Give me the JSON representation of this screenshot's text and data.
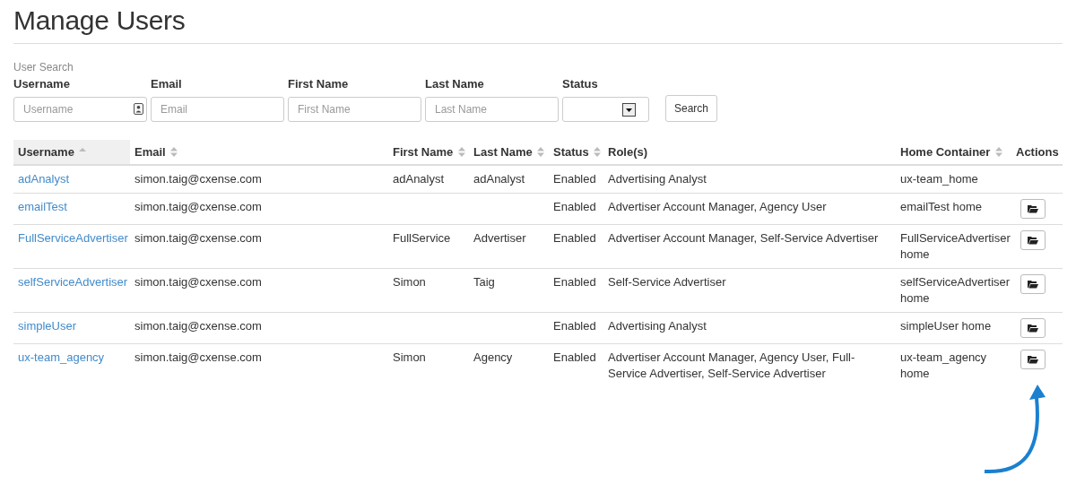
{
  "page": {
    "title": "Manage Users"
  },
  "search": {
    "heading": "User Search",
    "fields": [
      {
        "kind": "text",
        "label": "Username",
        "placeholder": "Username",
        "contact_icon": true
      },
      {
        "kind": "text",
        "label": "Email",
        "placeholder": "Email",
        "contact_icon": false
      },
      {
        "kind": "text",
        "label": "First Name",
        "placeholder": "First Name",
        "contact_icon": false
      },
      {
        "kind": "text",
        "label": "Last Name",
        "placeholder": "Last Name",
        "contact_icon": false
      },
      {
        "kind": "select",
        "label": "Status"
      }
    ],
    "button": "Search"
  },
  "table": {
    "columns": [
      {
        "label": "Username",
        "sortable": true,
        "sorted_ascending": true,
        "selected": true
      },
      {
        "label": "Email",
        "sortable": true,
        "sorted_ascending": false,
        "selected": false
      },
      {
        "label": "First Name",
        "sortable": true,
        "sorted_ascending": false,
        "selected": false
      },
      {
        "label": "Last Name",
        "sortable": true,
        "sorted_ascending": false,
        "selected": false
      },
      {
        "label": "Status",
        "sortable": true,
        "sorted_ascending": false,
        "selected": false
      },
      {
        "label": "Role(s)",
        "sortable": false,
        "selected": false
      },
      {
        "label": "Home Container",
        "sortable": true,
        "sorted_ascending": false,
        "selected": false
      },
      {
        "label": "Actions",
        "sortable": false,
        "selected": false
      }
    ],
    "rows": [
      {
        "username": "adAnalyst",
        "email": "simon.taig@cxense.com",
        "first_name": "adAnalyst",
        "last_name": "adAnalyst",
        "status": "Enabled",
        "roles": "Advertising Analyst",
        "home_container": "ux-team_home",
        "has_action": false
      },
      {
        "username": "emailTest",
        "email": "simon.taig@cxense.com",
        "first_name": "",
        "last_name": "",
        "status": "Enabled",
        "roles": "Advertiser Account Manager, Agency User",
        "home_container": "emailTest home",
        "has_action": true
      },
      {
        "username": "FullServiceAdvertiser",
        "email": "simon.taig@cxense.com",
        "first_name": "FullService",
        "last_name": "Advertiser",
        "status": "Enabled",
        "roles": "Advertiser Account Manager, Self-Service Advertiser",
        "home_container": "FullServiceAdvertiser home",
        "has_action": true
      },
      {
        "username": "selfServiceAdvertiser",
        "email": "simon.taig@cxense.com",
        "first_name": "Simon",
        "last_name": "Taig",
        "status": "Enabled",
        "roles": "Self-Service Advertiser",
        "home_container": "selfServiceAdvertiser home",
        "has_action": true
      },
      {
        "username": "simpleUser",
        "email": "simon.taig@cxense.com",
        "first_name": "",
        "last_name": "",
        "status": "Enabled",
        "roles": "Advertising Analyst",
        "home_container": "simpleUser home",
        "has_action": true
      },
      {
        "username": "ux-team_agency",
        "email": "simon.taig@cxense.com",
        "first_name": "Simon",
        "last_name": "Agency",
        "status": "Enabled",
        "roles": "Advertiser Account Manager, Agency User, Full-Service Advertiser, Self-Service Advertiser",
        "home_container": "ux-team_agency home",
        "has_action": true
      }
    ]
  },
  "annotation": {
    "arrow": true
  }
}
